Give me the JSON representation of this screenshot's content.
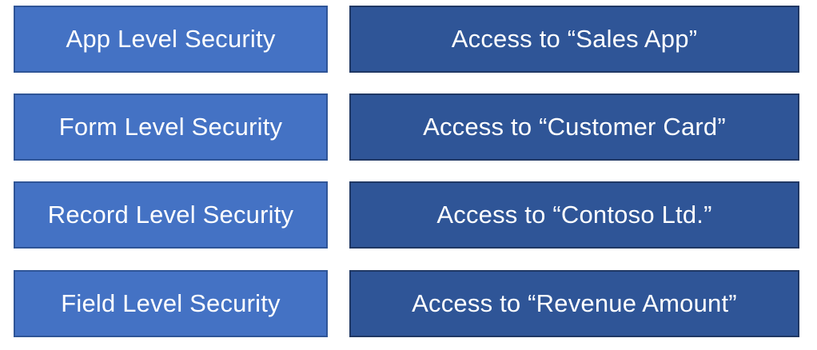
{
  "rows": [
    {
      "level": "App Level Security",
      "access": "Access to “Sales App”"
    },
    {
      "level": "Form Level Security",
      "access": "Access to “Customer Card”"
    },
    {
      "level": "Record Level Security",
      "access": "Access to “Contoso Ltd.”"
    },
    {
      "level": "Field Level Security",
      "access": "Access to “Revenue Amount”"
    }
  ],
  "colors": {
    "level_fill": "#4472c4",
    "access_fill": "#2f5597",
    "text": "#ffffff"
  }
}
